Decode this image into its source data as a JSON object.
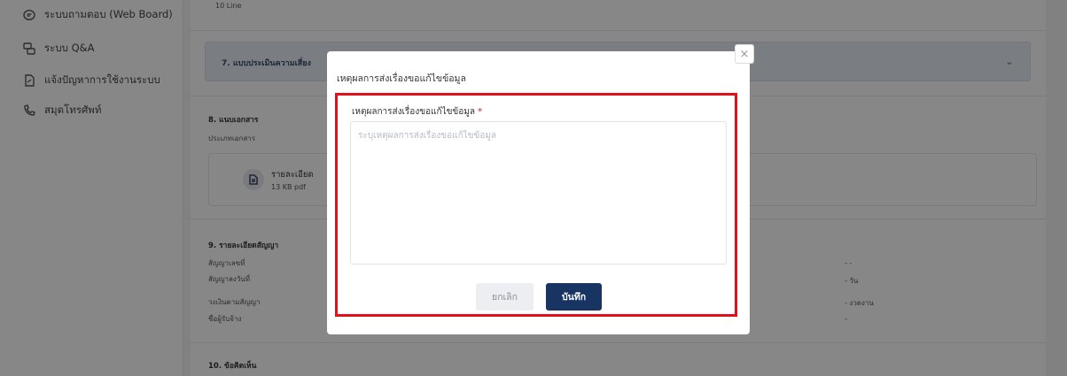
{
  "sidebar": {
    "items": [
      {
        "label": "ระบบถามตอบ (Web Board)",
        "icon": "chat-bubble-icon"
      },
      {
        "label": "ระบบ Q&A",
        "icon": "qa-icon"
      },
      {
        "label": "แจ้งปัญหาการใช้งานระบบ",
        "icon": "report-icon"
      },
      {
        "label": "สมุดโทรศัพท์",
        "icon": "phone-icon"
      }
    ]
  },
  "main": {
    "top_text": "10 Line",
    "section7": {
      "title": "7. แบบประเมินความเสี่ยง"
    },
    "section8": {
      "title": "8. แนบเอกสาร",
      "doc_type_label": "ประเภทเอกสาร",
      "file_name": "รายละเอียด",
      "file_size": "13 KB pdf"
    },
    "section9": {
      "title": "9. รายละเอียดสัญญา",
      "rows": [
        {
          "label": "สัญญาเลขที่",
          "value": "- -"
        },
        {
          "label": "สัญญาลงวันที่",
          "value": "- วัน"
        },
        {
          "label": "วงเงินตามสัญญา",
          "value": "- งวดงาน"
        },
        {
          "label": "ชื่อผู้รับจ้าง",
          "value": "-"
        }
      ]
    },
    "section10": {
      "title": "10. ข้อคิดเห็น"
    }
  },
  "modal": {
    "title": "เหตุผลการส่งเรื่องขอแก้ไขข้อมูล",
    "close_symbol": "×",
    "field_label": "เหตุผลการส่งเรื่องขอแก้ไขข้อมูล",
    "required_mark": "*",
    "textarea_value": "",
    "placeholder": "ระบุเหตุผลการส่งเรื่องขอแก้ไขข้อมูล",
    "cancel_label": "ยกเลิก",
    "save_label": "บันทึก",
    "highlight_color": "#e0111a",
    "primary_color": "#173463"
  }
}
